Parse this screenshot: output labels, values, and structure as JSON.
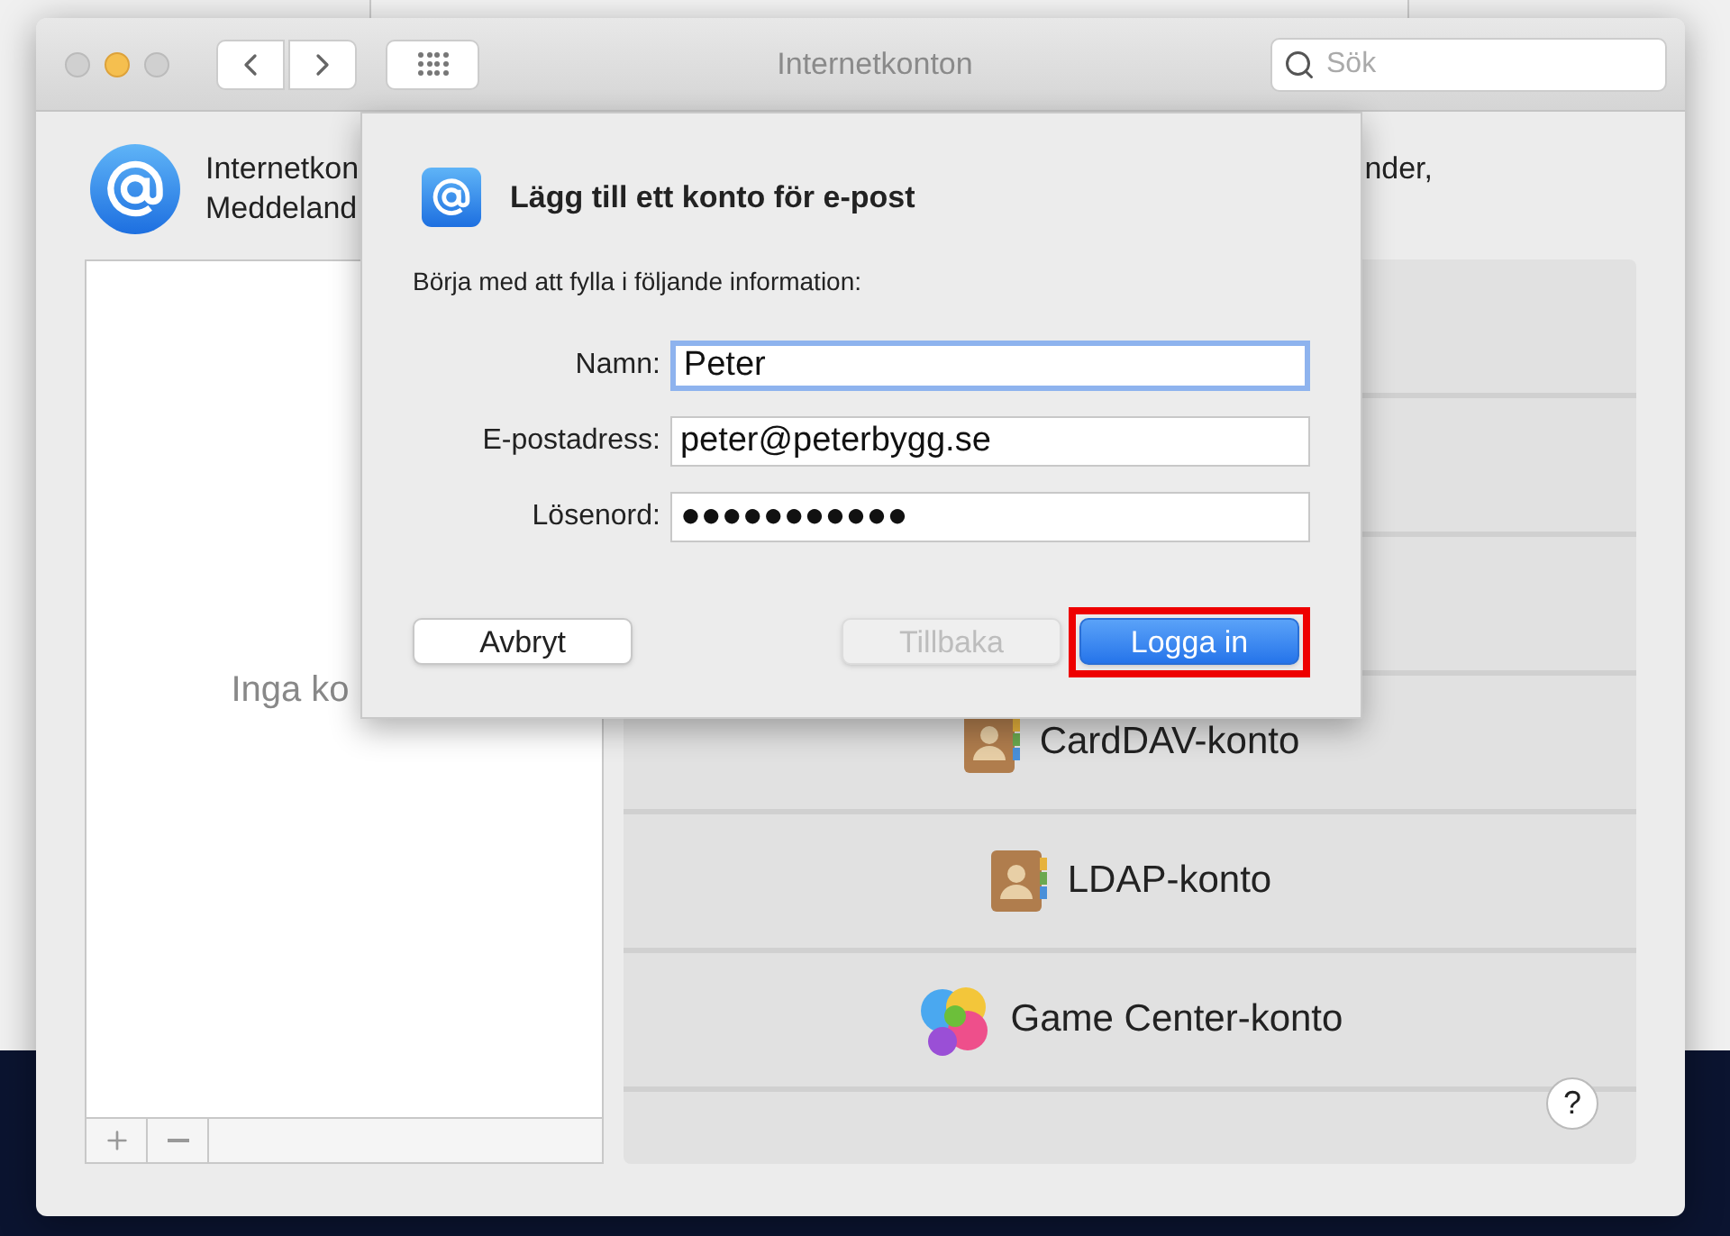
{
  "window": {
    "title": "Internetkonton",
    "search": {
      "placeholder": "Sök"
    }
  },
  "header": {
    "text_left": [
      "Internetkon",
      "Meddeland"
    ],
    "text_right": "nder,"
  },
  "accounts_list": {
    "empty_text": "Inga ko"
  },
  "providers": [
    {
      "kind": "hidden"
    },
    {
      "kind": "hidden"
    },
    {
      "kind": "hidden"
    },
    {
      "label": "CardDAV-konto",
      "kind": "contacts"
    },
    {
      "label": "LDAP-konto",
      "kind": "contacts"
    },
    {
      "label": "Game Center-konto",
      "kind": "gamecenter"
    }
  ],
  "help": "?",
  "sheet": {
    "title": "Lägg till ett konto för e-post",
    "intro": "Börja med att fylla i följande information:",
    "fields": [
      {
        "label": "Namn:",
        "value": "Peter",
        "focused": true
      },
      {
        "label": "E-postadress:",
        "value": "peter@peterbygg.se",
        "focused": false
      },
      {
        "label": "Lösenord:",
        "value": "●●●●●●●●●●●",
        "focused": false
      }
    ],
    "buttons": [
      {
        "label": "Avbryt",
        "kind": "normal",
        "disabled": false
      },
      {
        "label": "Tillbaka",
        "kind": "normal",
        "disabled": true
      },
      {
        "label": "Logga in",
        "kind": "default",
        "disabled": false,
        "highlighted": true
      }
    ]
  }
}
